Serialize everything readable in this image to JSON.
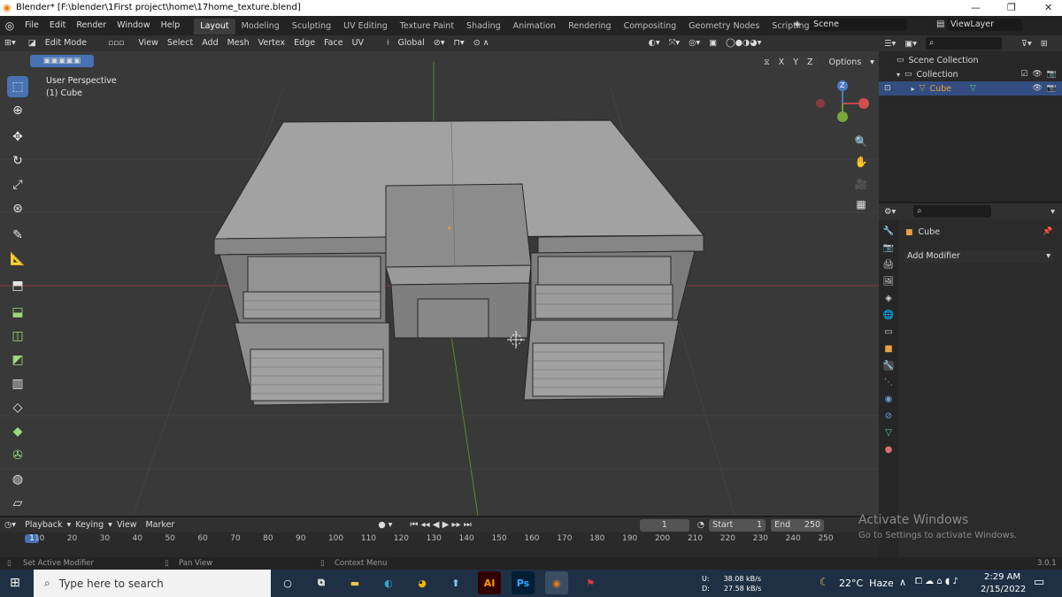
{
  "window": {
    "title": "Blender* [F:\\blender\\1First project\\home\\17home_texture.blend]",
    "min_icon": "minimize-icon",
    "max_icon": "maximize-icon",
    "close_icon": "close-icon"
  },
  "menu": [
    "File",
    "Edit",
    "Render",
    "Window",
    "Help"
  ],
  "workspaces": [
    "Layout",
    "Modeling",
    "Sculpting",
    "UV Editing",
    "Texture Paint",
    "Shading",
    "Animation",
    "Rendering",
    "Compositing",
    "Geometry Nodes",
    "Scripting"
  ],
  "workspace_add": "+",
  "scene": {
    "label": "Scene",
    "view_layer": "ViewLayer"
  },
  "viewport": {
    "mode": "Edit Mode",
    "menus": [
      "View",
      "Select",
      "Add",
      "Mesh",
      "Vertex",
      "Edge",
      "Face",
      "UV"
    ],
    "transform": "Global",
    "overlay_title": "User Perspective",
    "overlay_object": "(1) Cube",
    "axes": [
      "X",
      "Y",
      "Z"
    ],
    "options": "Options",
    "gizmo_z": "Z"
  },
  "outliner": {
    "scene_collection": "Scene Collection",
    "collection": "Collection",
    "object": "Cube"
  },
  "properties": {
    "object": "Cube",
    "add_modifier": "Add Modifier"
  },
  "timeline": {
    "menus": [
      "Playback",
      "Keying",
      "View",
      "Marker"
    ],
    "current_frame": "1",
    "start_label": "Start",
    "start": "1",
    "end_label": "End",
    "end": "250",
    "ticks": [
      "1",
      "10",
      "20",
      "30",
      "40",
      "50",
      "60",
      "70",
      "80",
      "90",
      "100",
      "110",
      "120",
      "130",
      "140",
      "150",
      "160",
      "170",
      "180",
      "190",
      "200",
      "210",
      "220",
      "230",
      "240",
      "250"
    ]
  },
  "status": {
    "left": "Set Active Modifier",
    "mid": "Pan View",
    "right": "Context Menu",
    "version": "3.0.1"
  },
  "activate": {
    "title": "Activate Windows",
    "sub": "Go to Settings to activate Windows."
  },
  "taskbar": {
    "search_placeholder": "Type here to search",
    "apps": [
      "AI",
      "Ps"
    ],
    "net_up_label": "U:",
    "net_up": "38.08 kB/s",
    "net_down_label": "D:",
    "net_down": "27.58 kB/s",
    "weather": "22°C  Haze",
    "time": "2:29 AM",
    "date": "2/15/2022"
  },
  "colors": {
    "accent": "#4772b3",
    "grid": "#393939",
    "mesh": "#8f8f8f",
    "taskbar": "#1f2f44"
  }
}
